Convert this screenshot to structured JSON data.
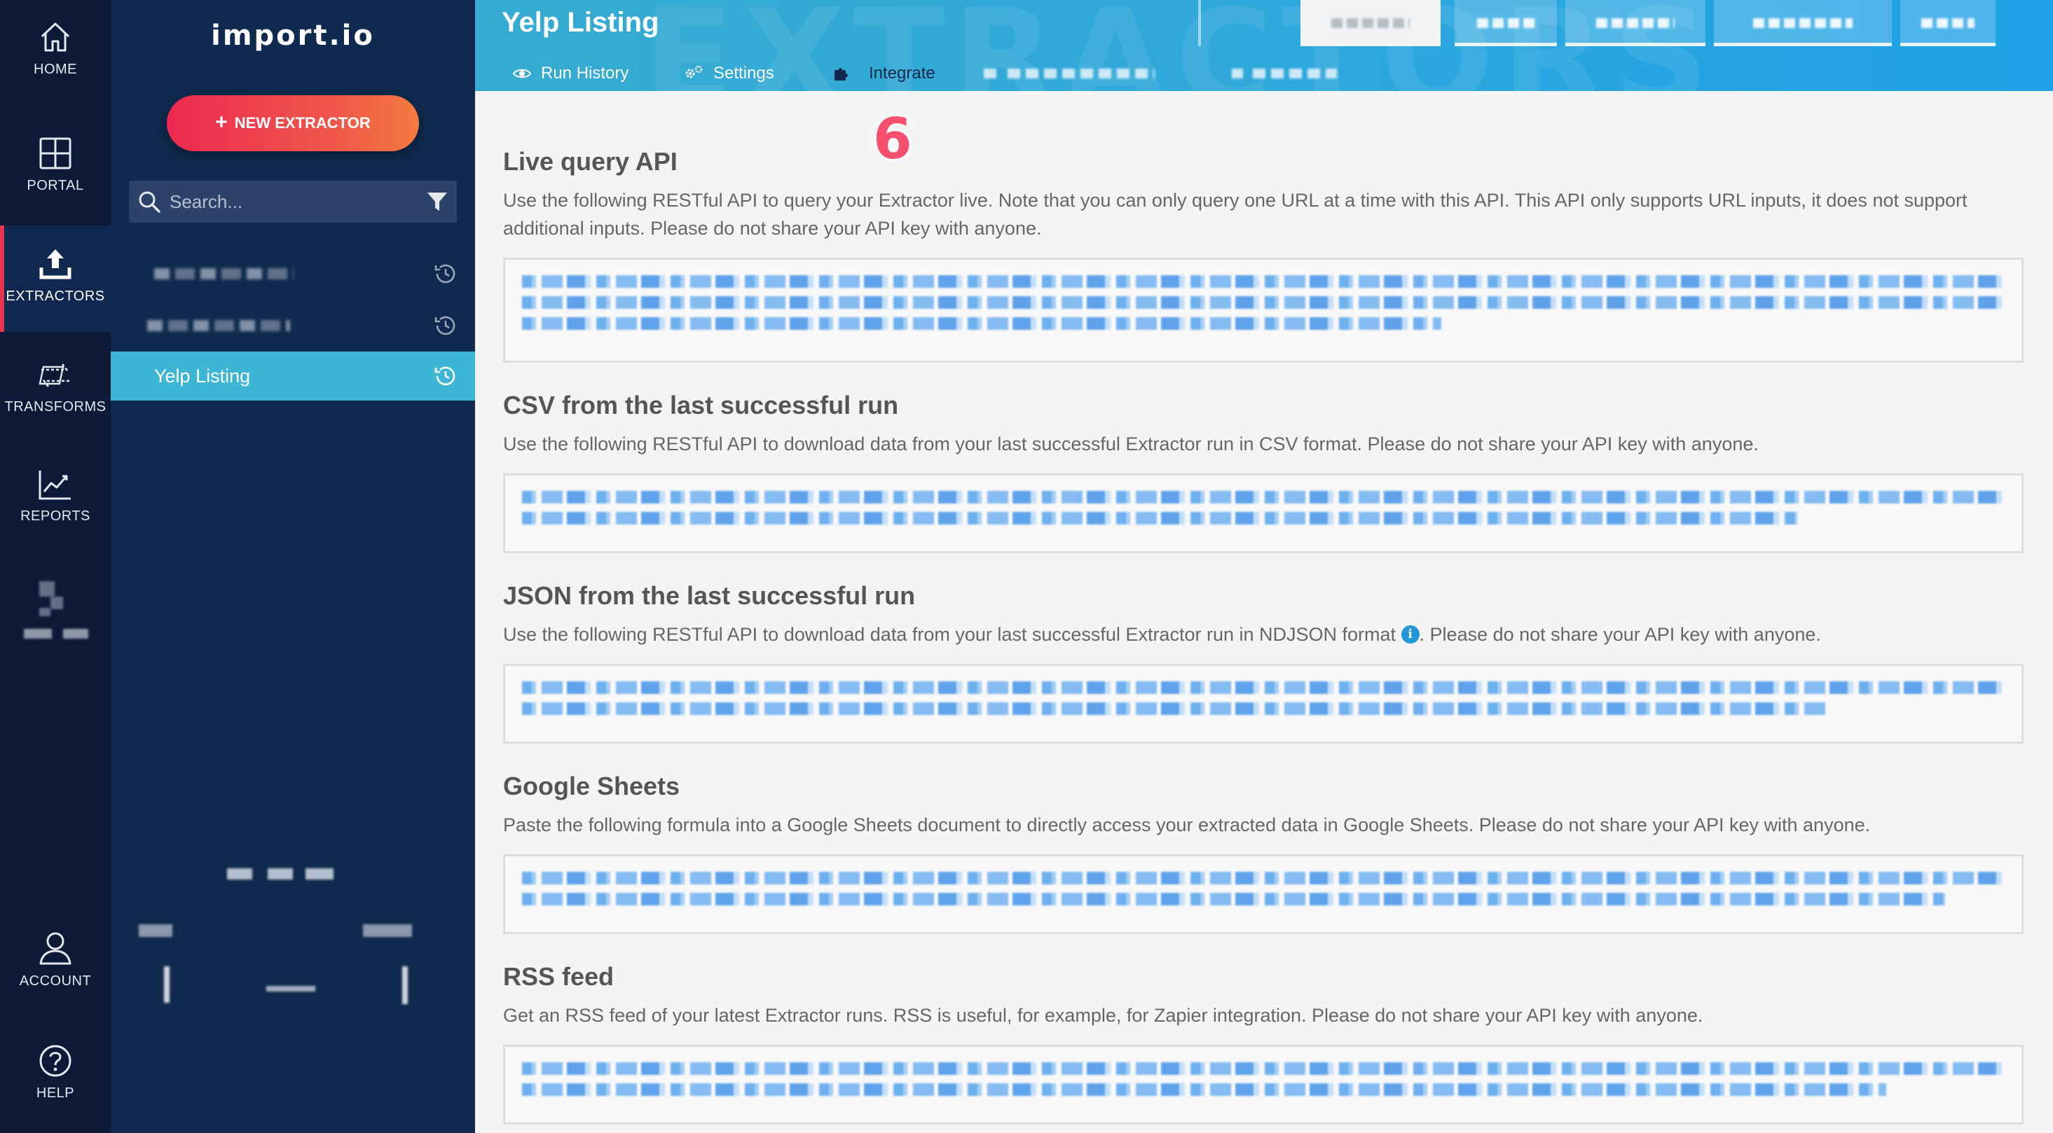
{
  "brand": {
    "logo_text": "import.io"
  },
  "rail": {
    "items": [
      {
        "label": "HOME"
      },
      {
        "label": "PORTAL"
      },
      {
        "label": "EXTRACTORS"
      },
      {
        "label": "TRANSFORMS"
      },
      {
        "label": "REPORTS"
      },
      {
        "label": "ACCOUNT"
      },
      {
        "label": "HELP"
      }
    ],
    "active": "EXTRACTORS"
  },
  "sidebar": {
    "new_button_label": "NEW EXTRACTOR",
    "search_placeholder": "Search...",
    "extractors": [
      {
        "name": "",
        "blurred": true
      },
      {
        "name": "",
        "blurred": true
      },
      {
        "name": "Yelp Listing",
        "blurred": false,
        "selected": true
      }
    ]
  },
  "header": {
    "title": "Yelp Listing",
    "tabs": [
      {
        "label": "Run History",
        "icon": "eye-icon"
      },
      {
        "label": "Settings",
        "icon": "gears-icon"
      },
      {
        "label": "Integrate",
        "icon": "puzzle-icon",
        "active": true
      }
    ]
  },
  "annotation": {
    "step": "6"
  },
  "sections": [
    {
      "title": "Live query API",
      "description": "Use the following RESTful API to query your Extractor live. Note that you can only query one URL at a time with this API. This API only supports URL inputs, it does not support additional inputs. Please do not share your API key with anyone."
    },
    {
      "title": "CSV from the last successful run",
      "description": "Use the following RESTful API to download data from your last successful Extractor run in CSV format. Please do not share your API key with anyone."
    },
    {
      "title": "JSON from the last successful run",
      "description_before": "Use the following RESTful API to download data from your last successful Extractor run in NDJSON format",
      "description_after": ". Please do not share your API key with anyone."
    },
    {
      "title": "Google Sheets",
      "description": "Paste the following formula into a Google Sheets document to directly access your extracted data in Google Sheets. Please do not share your API key with anyone."
    },
    {
      "title": "RSS feed",
      "description": "Get an RSS feed of your latest Extractor runs. RSS is useful, for example, for Zapier integration. Please do not share your API key with anyone."
    }
  ],
  "colors": {
    "rail_bg": "#0c1a38",
    "sidebar_bg": "#0f2a4e",
    "selected_item": "#3cb6d4",
    "accent_red": "#e8344e",
    "header_blue": "#2fa8db",
    "step_badge": "#f6506e"
  }
}
